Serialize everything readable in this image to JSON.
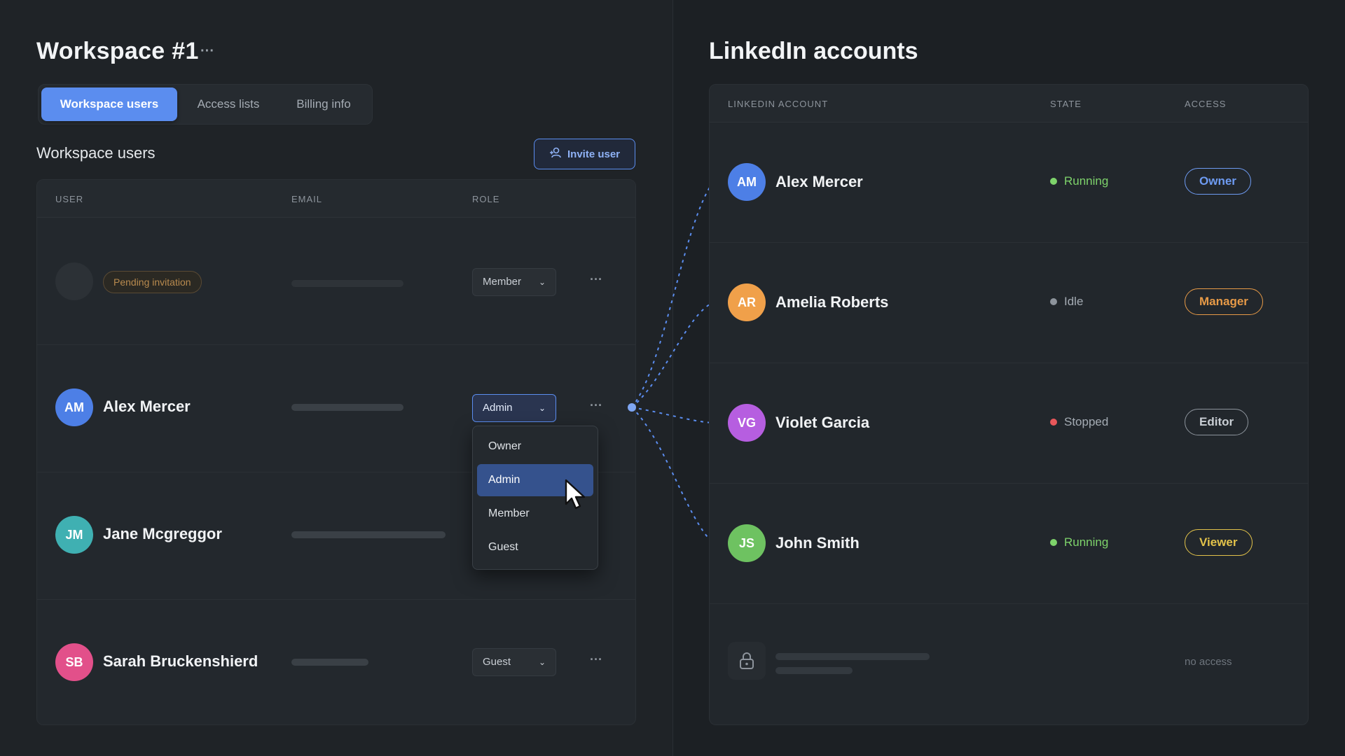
{
  "workspace": {
    "title": "Workspace #1",
    "more_icon": "ellipsis-icon",
    "tabs": [
      {
        "label": "Workspace users",
        "active": true
      },
      {
        "label": "Access lists",
        "active": false
      },
      {
        "label": "Billing info",
        "active": false
      }
    ],
    "section_title": "Workspace users",
    "invite_button": "Invite user",
    "table": {
      "headers": [
        "USER",
        "EMAIL",
        "ROLE"
      ],
      "rows": [
        {
          "name": "",
          "initials": "",
          "badge": "Pending invitation",
          "role": "Member",
          "pending": true
        },
        {
          "name": "Alex Mercer",
          "initials": "AM",
          "role": "Admin",
          "color": "#4d7fe6"
        },
        {
          "name": "Jane Mcgreggor",
          "initials": "JM",
          "role": "",
          "color": "#3fb0b2"
        },
        {
          "name": "Sarah Bruckenshierd",
          "initials": "SB",
          "role": "Guest",
          "color": "#e2508a"
        }
      ]
    },
    "dropdown": {
      "options": [
        "Owner",
        "Admin",
        "Member",
        "Guest"
      ],
      "selected": "Admin"
    }
  },
  "linkedin": {
    "title": "LinkedIn accounts",
    "headers": [
      "LINKEDIN ACCOUNT",
      "STATE",
      "ACCESS"
    ],
    "rows": [
      {
        "name": "Alex Mercer",
        "initials": "AM",
        "state": "Running",
        "access": "Owner",
        "avatar_color": "#4d7fe6",
        "state_color": "#7ed36b",
        "access_color": "#6e9bf2"
      },
      {
        "name": "Amelia Roberts",
        "initials": "AR",
        "state": "Idle",
        "access": "Manager",
        "avatar_color": "#f0a04a",
        "state_color": "#8d949c",
        "access_color": "#e79a47"
      },
      {
        "name": "Violet Garcia",
        "initials": "VG",
        "state": "Stopped",
        "access": "Editor",
        "avatar_color": "#b65ee0",
        "state_color": "#e8575a",
        "access_color": "#c9ced4"
      },
      {
        "name": "John Smith",
        "initials": "JS",
        "state": "Running",
        "access": "Viewer",
        "avatar_color": "#6ec261",
        "state_color": "#7ed36b",
        "access_color": "#e2c24a"
      }
    ],
    "locked_row": {
      "label": "no access"
    }
  },
  "colors": {
    "accent": "#5b8def",
    "background": "#1e2226"
  }
}
